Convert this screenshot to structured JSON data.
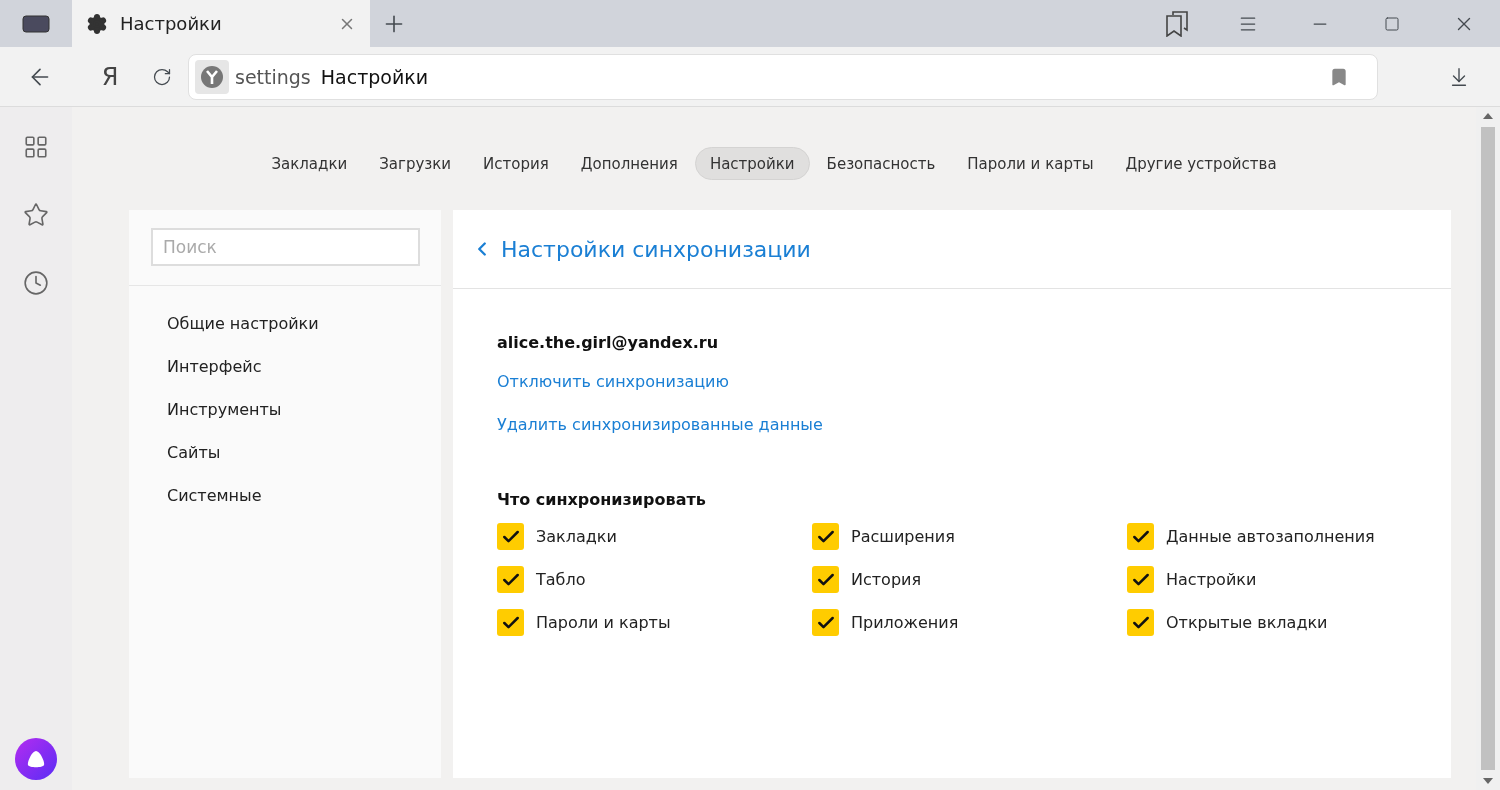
{
  "browser": {
    "tab": {
      "title": "Настройки"
    },
    "home_button": "Я",
    "address": {
      "host": "settings",
      "title": "Настройки"
    }
  },
  "nav_tabs": [
    {
      "label": "Закладки",
      "selected": false
    },
    {
      "label": "Загрузки",
      "selected": false
    },
    {
      "label": "История",
      "selected": false
    },
    {
      "label": "Дополнения",
      "selected": false
    },
    {
      "label": "Настройки",
      "selected": true
    },
    {
      "label": "Безопасность",
      "selected": false
    },
    {
      "label": "Пароли и карты",
      "selected": false
    },
    {
      "label": "Другие устройства",
      "selected": false
    }
  ],
  "sidebar": {
    "search": {
      "placeholder": "Поиск"
    },
    "items": [
      "Общие настройки",
      "Интерфейс",
      "Инструменты",
      "Сайты",
      "Системные"
    ]
  },
  "panel": {
    "title": "Настройки синхронизации",
    "account": "alice.the.girl@yandex.ru",
    "links": [
      "Отключить синхронизацию",
      "Удалить синхронизированные данные"
    ],
    "sync_heading": "Что синхронизировать",
    "sync_items": [
      {
        "label": "Закладки",
        "checked": true
      },
      {
        "label": "Расширения",
        "checked": true
      },
      {
        "label": "Данные автозаполнения",
        "checked": true
      },
      {
        "label": "Табло",
        "checked": true
      },
      {
        "label": "История",
        "checked": true
      },
      {
        "label": "Настройки",
        "checked": true
      },
      {
        "label": "Пароли и карты",
        "checked": true
      },
      {
        "label": "Приложения",
        "checked": true
      },
      {
        "label": "Открытые вкладки",
        "checked": true
      }
    ]
  }
}
